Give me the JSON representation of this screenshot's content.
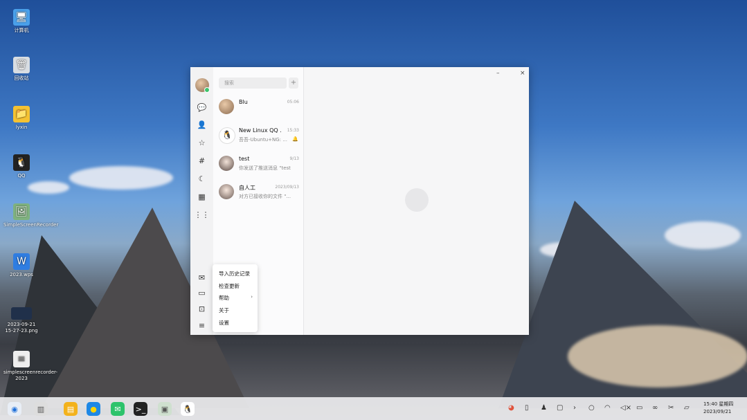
{
  "desktop": {
    "icons": [
      {
        "label": "计算机",
        "icon": "computer-icon"
      },
      {
        "label": "回收站",
        "icon": "trash-icon"
      },
      {
        "label": "lyxin",
        "icon": "folder-icon"
      },
      {
        "label": "QQ",
        "icon": "qq-penguin-icon"
      },
      {
        "label": "SimpleScreenRecorder",
        "icon": "image-viewer-icon"
      },
      {
        "label": "2023.wps",
        "icon": "wps-doc-icon"
      },
      {
        "label": "2023-09-21 15-27-23.png",
        "icon": "png-thumbnail-icon"
      },
      {
        "label": "simplescreenrecorder-2023",
        "icon": "text-file-icon"
      }
    ]
  },
  "window": {
    "controls": {
      "minimize": "–",
      "close": "×"
    },
    "search_placeholder": "搜索",
    "add_symbol": "+",
    "conversations": [
      {
        "name": "Blu",
        "time": "05:06",
        "message": "",
        "badge": ""
      },
      {
        "name": "New Linux QQ ...",
        "time": "15:33",
        "message": "吾吾-Ubuntu+NG: ...",
        "badge": "🔔"
      },
      {
        "name": "test",
        "time": "9/13",
        "message": "你发送了推送消息 \"test\"",
        "badge": ""
      },
      {
        "name": "自人工",
        "time": "2023/09/13",
        "message": "对方已接收你的文件 \"...\"",
        "badge": ""
      }
    ],
    "menu": {
      "items": [
        "导入历史记录",
        "检查更新",
        "帮助",
        "关于",
        "设置"
      ]
    }
  },
  "taskbar": {
    "clock_time": "15:40 星期四",
    "clock_date": "2023/09/21"
  },
  "colors": {
    "online": "#3cc46c",
    "accent": "#1e90ff"
  }
}
